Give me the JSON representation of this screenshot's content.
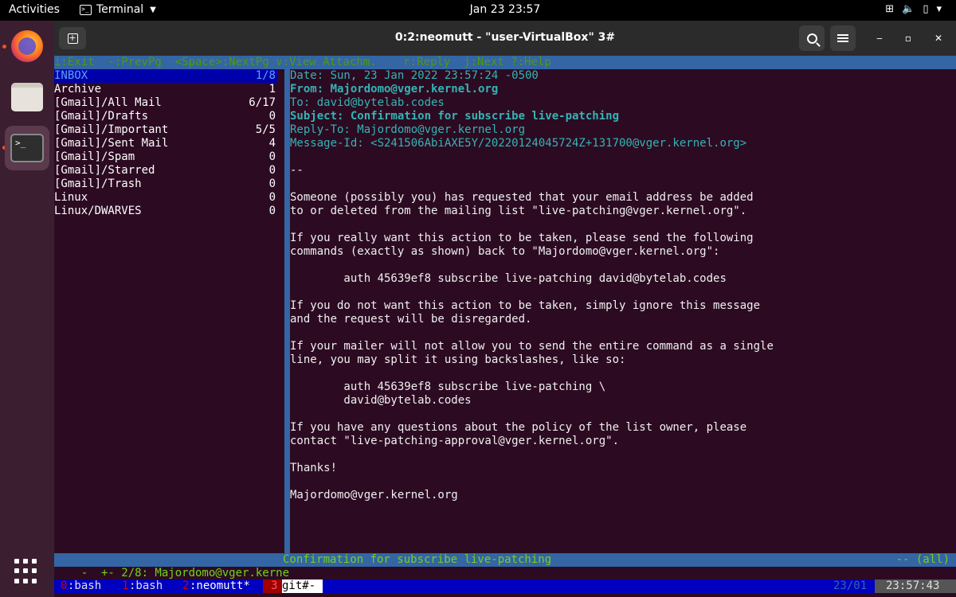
{
  "topbar": {
    "activities": "Activities",
    "app_name": "Terminal",
    "clock": "Jan 23  23:57"
  },
  "dock": {
    "items": [
      "firefox-icon",
      "files-icon",
      "terminal-icon",
      "show-apps-icon"
    ]
  },
  "window": {
    "title": "0:2:neomutt - \"user-VirtualBox\" 3#"
  },
  "helpbar": {
    "text": "i:Exit  -:PrevPg  <Space>:NextPg v:View Attachm.    r:Reply  j:Next ?:Help"
  },
  "sidebar": {
    "items": [
      {
        "name": "INBOX",
        "count": "1/8"
      },
      {
        "name": "Archive",
        "count": "1"
      },
      {
        "name": "[Gmail]/All Mail",
        "count": "6/17"
      },
      {
        "name": "[Gmail]/Drafts",
        "count": "0"
      },
      {
        "name": "[Gmail]/Important",
        "count": "5/5"
      },
      {
        "name": "[Gmail]/Sent Mail",
        "count": "4"
      },
      {
        "name": "[Gmail]/Spam",
        "count": "0"
      },
      {
        "name": "[Gmail]/Starred",
        "count": "0"
      },
      {
        "name": "[Gmail]/Trash",
        "count": "0"
      },
      {
        "name": "Linux",
        "count": "0"
      },
      {
        "name": "Linux/DWARVES",
        "count": "0"
      }
    ]
  },
  "message": {
    "date": "Date: Sun, 23 Jan 2022 23:57:24 -0500",
    "from": "From: Majordomo@vger.kernel.org",
    "to": "To: david@bytelab.codes",
    "subject": "Subject: Confirmation for subscribe live-patching",
    "reply_to": "Reply-To: Majordomo@vger.kernel.org",
    "message_id": "Message-Id: <S241506AbiAXE5Y/20220124045724Z+131700@vger.kernel.org>",
    "body": [
      "--",
      "",
      "Someone (possibly you) has requested that your email address be added",
      "to or deleted from the mailing list \"live-patching@vger.kernel.org\".",
      "",
      "If you really want this action to be taken, please send the following",
      "commands (exactly as shown) back to \"Majordomo@vger.kernel.org\":",
      "",
      "        auth 45639ef8 subscribe live-patching david@bytelab.codes",
      "",
      "If you do not want this action to be taken, simply ignore this message",
      "and the request will be disregarded.",
      "",
      "If your mailer will not allow you to send the entire command as a single",
      "line, you may split it using backslashes, like so:",
      "",
      "        auth 45639ef8 subscribe live-patching \\",
      "        david@bytelab.codes",
      "",
      "If you have any questions about the policy of the list owner, please",
      "contact \"live-patching-approval@vger.kernel.org\".",
      "",
      "Thanks!",
      "",
      "Majordomo@vger.kernel.org"
    ]
  },
  "status": {
    "left": "-  +- 2/8: Majordomo@vger.kerne",
    "mid": "Confirmation for subscribe live-patching",
    "right": "-- (all)"
  },
  "tmux": {
    "w0_idx": "0",
    "w0_name": ":bash",
    "w1_idx": "1",
    "w1_name": ":bash",
    "w2_idx": "2",
    "w2_name": ":neomutt*",
    "git_idx": "3",
    "git_name": "git#-",
    "date": "23/01",
    "time": "23:57:43"
  },
  "colors": {
    "terminal_bg": "#2c0b22",
    "bar_blue": "#3465a4",
    "header_cyan": "#34b4b4",
    "help_green": "#73d216"
  }
}
